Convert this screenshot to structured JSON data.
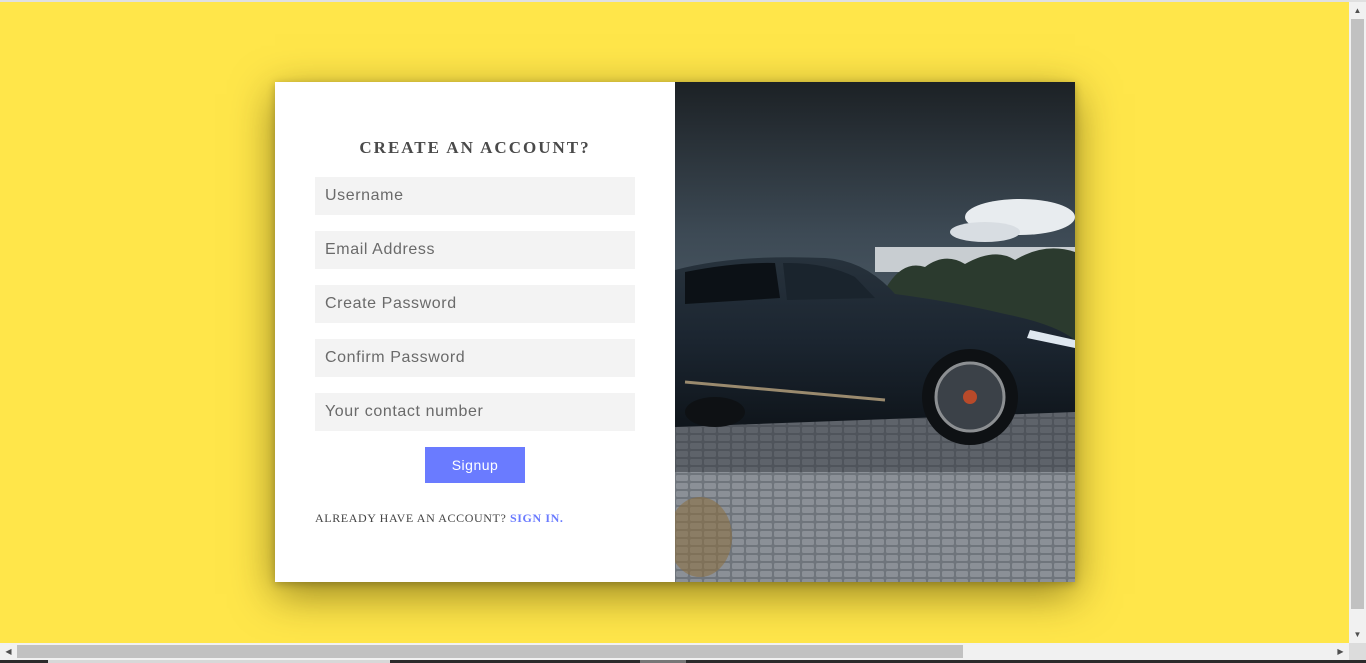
{
  "form": {
    "title": "CREATE AN ACCOUNT?",
    "fields": [
      {
        "placeholder": "Username",
        "value": ""
      },
      {
        "placeholder": "Email Address",
        "value": ""
      },
      {
        "placeholder": "Create Password",
        "value": ""
      },
      {
        "placeholder": "Confirm Password",
        "value": ""
      },
      {
        "placeholder": "Your contact number",
        "value": ""
      }
    ],
    "submit_label": "Signup",
    "signin_prompt": "ALREADY HAVE AN ACCOUNT?",
    "signin_link": "SIGN IN."
  },
  "hero_image": {
    "subject": "car-photo"
  },
  "colors": {
    "background": "#ffe64a",
    "accent": "#6a7bff",
    "card": "#ffffff",
    "field": "#f3f3f3"
  },
  "icons": {
    "scroll_up": "triangle-up-icon",
    "scroll_down": "triangle-down-icon",
    "scroll_left": "triangle-left-icon",
    "scroll_right": "triangle-right-icon"
  }
}
